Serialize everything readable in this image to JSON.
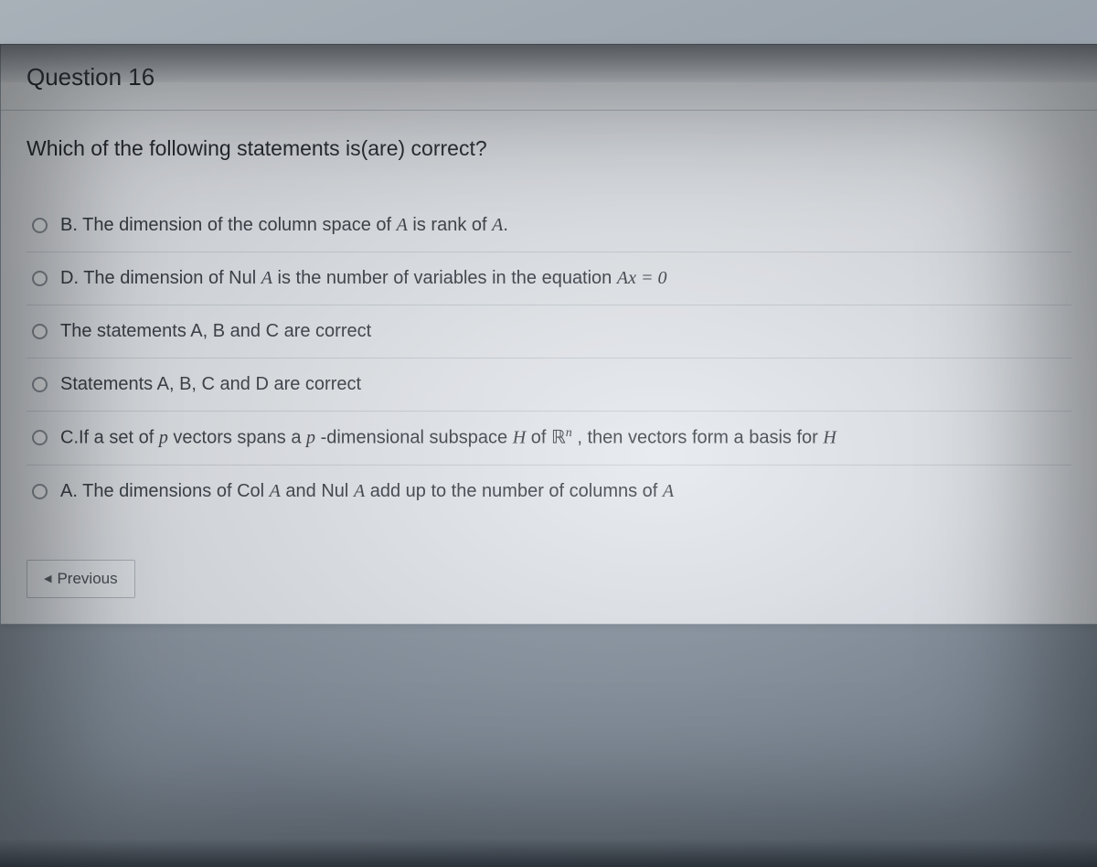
{
  "question": {
    "header": "Question 16",
    "prompt": "Which of the following statements is(are) correct?",
    "options": [
      {
        "prefix": "B.",
        "text_pre": "The dimension of the column space of ",
        "var1": "A",
        "text_mid": " is rank of ",
        "var2": "A",
        "text_post": "."
      },
      {
        "prefix": "D.",
        "text_pre": "The dimension of Nul ",
        "var1": "A",
        "text_mid": "  is the number of variables in the equation ",
        "eq": "Ax = 0"
      },
      {
        "plain": "The statements A, B and C are correct"
      },
      {
        "plain": "Statements A, B, C and D are correct"
      },
      {
        "prefix": "C.",
        "text_pre": "If a set of ",
        "var1": "p",
        "text_mid": " vectors spans a ",
        "var2": "p",
        "text_mid2": " -dimensional subspace ",
        "var3": "H",
        "text_mid3": " of ",
        "rn": "ℝ",
        "rn_sup": "n",
        "text_post": " , then vectors form a basis for ",
        "var4": "H"
      },
      {
        "prefix": "A.",
        "text_pre": "The dimensions of Col ",
        "var1": "A",
        "text_mid": " and Nul ",
        "var2": "A",
        "text_post": " add up to the number of columns of ",
        "var3": "A"
      }
    ]
  },
  "nav": {
    "previous_label": "Previous"
  }
}
